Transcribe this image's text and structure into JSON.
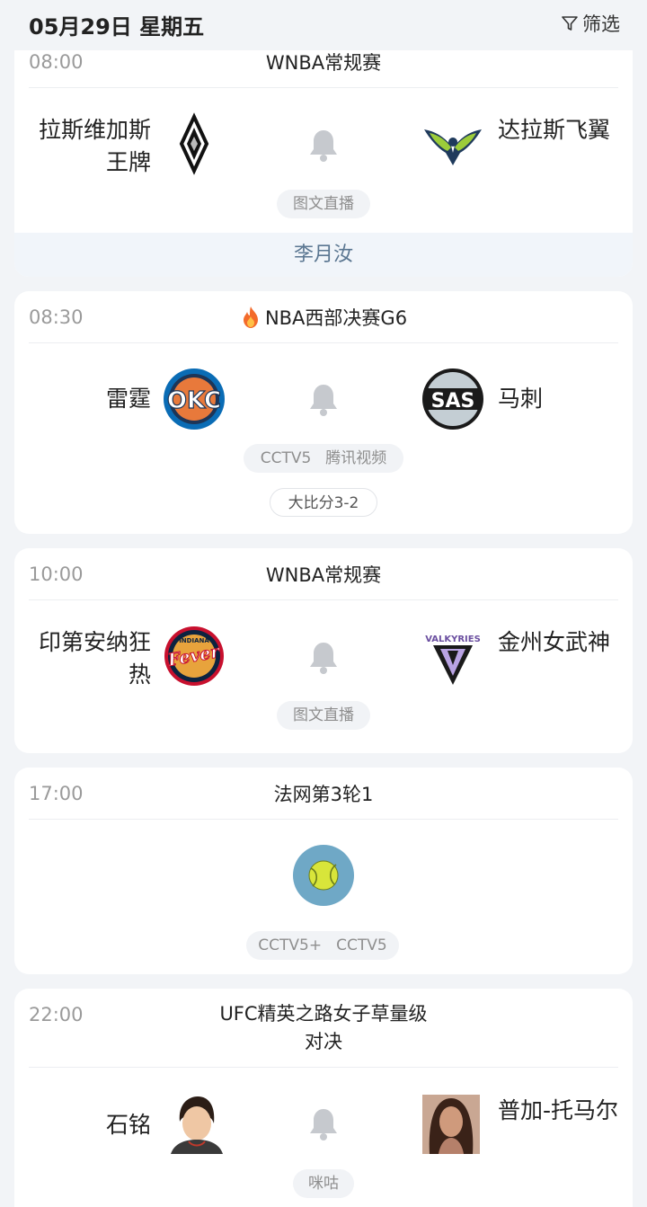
{
  "header": {
    "date": "05月29日 星期五",
    "filter_label": "筛选"
  },
  "matches": [
    {
      "time": "08:00",
      "title": "WNBA常规赛",
      "home": "拉斯维加斯王牌",
      "away": "达拉斯飞翼",
      "broadcast": [
        "图文直播"
      ],
      "featured": "李月汝"
    },
    {
      "time": "08:30",
      "title": "NBA西部决赛G6",
      "hot": true,
      "home": "雷霆",
      "away": "马刺",
      "home_logo_text": "OKC",
      "away_logo_text": "SAS",
      "broadcast": [
        "CCTV5",
        "腾讯视频"
      ],
      "series_score": "大比分3-2"
    },
    {
      "time": "10:00",
      "title": "WNBA常规赛",
      "home": "印第安纳狂热",
      "away": "金州女武神",
      "home_logo_text": "Fever",
      "home_logo_small": "INDIANA",
      "away_logo_text": "VALKYRIES",
      "broadcast": [
        "图文直播"
      ]
    },
    {
      "time": "17:00",
      "title": "法网第3轮1",
      "broadcast": [
        "CCTV5+",
        "CCTV5"
      ]
    },
    {
      "time": "22:00",
      "title": "UFC精英之路女子草量级对决",
      "home": "石铭",
      "away": "普加-托马尔",
      "broadcast": [
        "咪咕"
      ]
    }
  ],
  "colors": {
    "accent": "#5a7691",
    "card": "#ffffff",
    "background": "#f2f4f7"
  }
}
